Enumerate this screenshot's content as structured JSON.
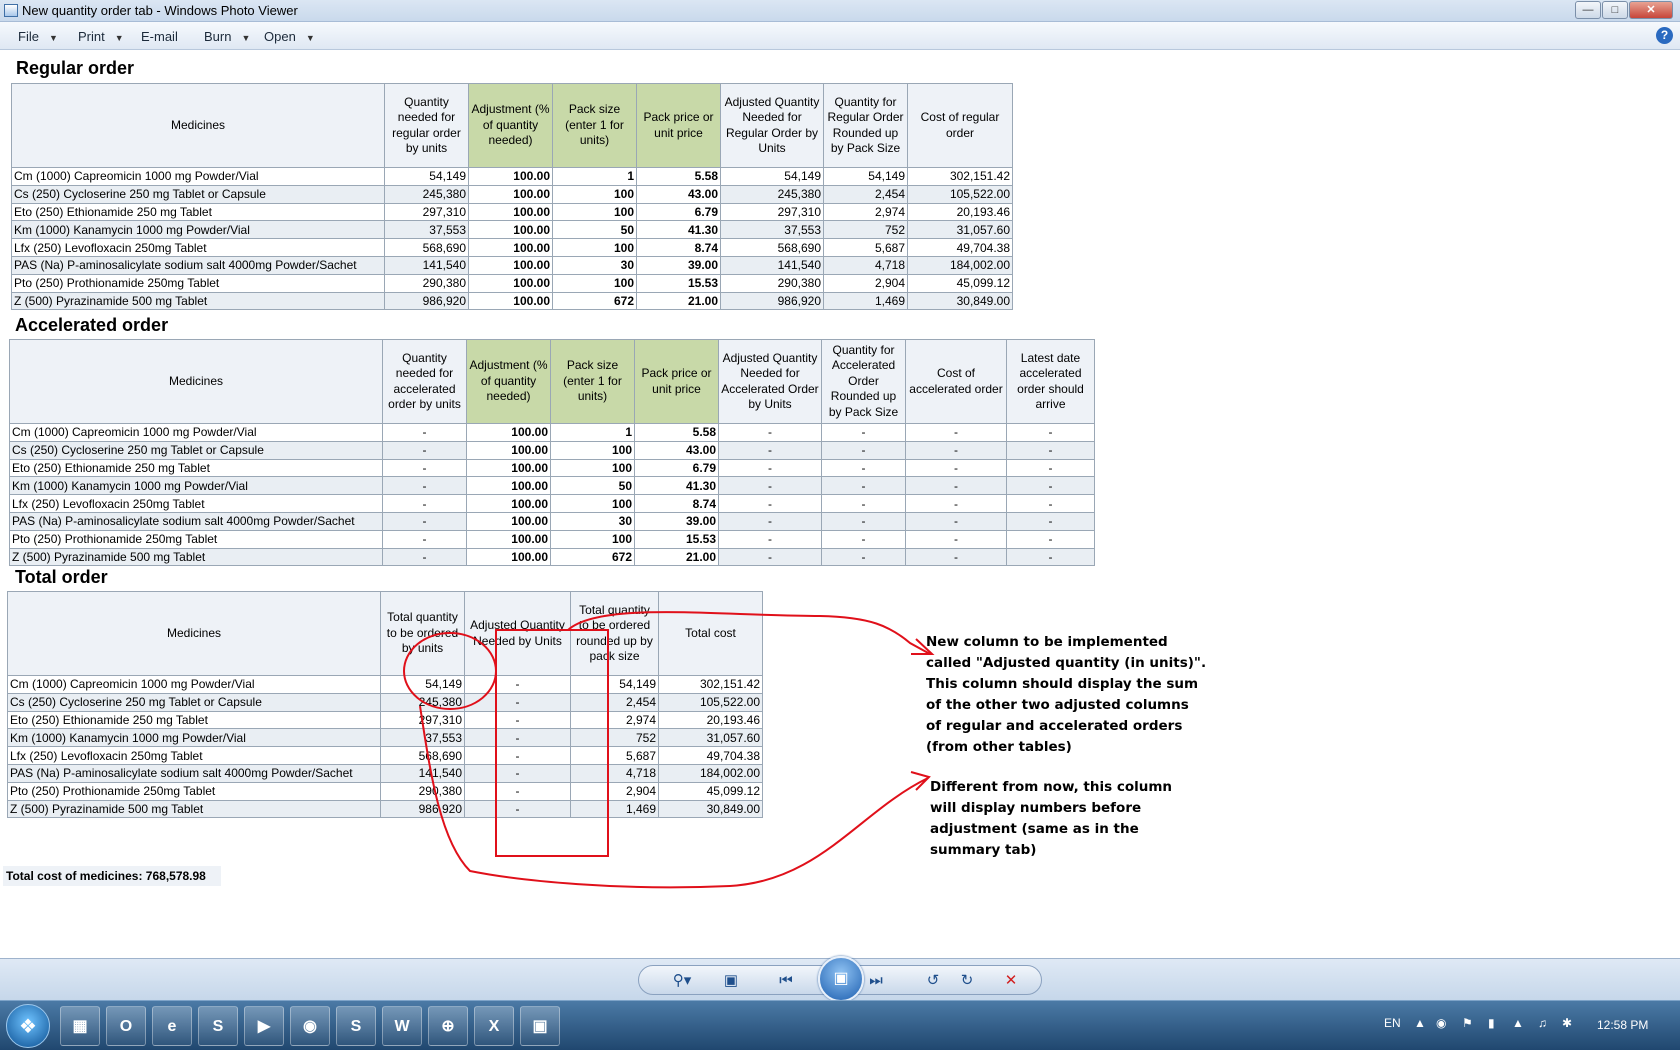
{
  "window": {
    "title": "New quantity order tab - Windows Photo Viewer",
    "controls": [
      "minimize-icon",
      "maximize-icon",
      "close-icon"
    ]
  },
  "menu": {
    "items": [
      {
        "label": "File",
        "has_caret": true
      },
      {
        "label": "Print",
        "has_caret": true
      },
      {
        "label": "E-mail",
        "has_caret": false
      },
      {
        "label": "Burn",
        "has_caret": true
      },
      {
        "label": "Open",
        "has_caret": true
      }
    ],
    "help": "?"
  },
  "regular": {
    "title": "Regular order",
    "headers": [
      "Medicines",
      "Quantity needed for regular order by units",
      "Adjustment (% of quantity needed)",
      "Pack size (enter 1 for units)",
      "Pack price or unit price",
      "Adjusted Quantity Needed for Regular Order by Units",
      "Quantity for Regular Order Rounded up by Pack Size",
      "Cost of regular order"
    ],
    "rows": [
      [
        "Cm (1000)  Capreomicin  1000 mg  Powder/Vial",
        "54,149",
        "100.00",
        "1",
        "5.58",
        "54,149",
        "54,149",
        "302,151.42"
      ],
      [
        "Cs (250)  Cycloserine  250 mg  Tablet or Capsule",
        "245,380",
        "100.00",
        "100",
        "43.00",
        "245,380",
        "2,454",
        "105,522.00"
      ],
      [
        "Eto (250)  Ethionamide  250 mg  Tablet",
        "297,310",
        "100.00",
        "100",
        "6.79",
        "297,310",
        "2,974",
        "20,193.46"
      ],
      [
        "Km (1000)  Kanamycin  1000 mg  Powder/Vial",
        "37,553",
        "100.00",
        "50",
        "41.30",
        "37,553",
        "752",
        "31,057.60"
      ],
      [
        "Lfx (250)  Levofloxacin  250mg  Tablet",
        "568,690",
        "100.00",
        "100",
        "8.74",
        "568,690",
        "5,687",
        "49,704.38"
      ],
      [
        "PAS (Na)  P-aminosalicylate sodium salt  4000mg  Powder/Sachet",
        "141,540",
        "100.00",
        "30",
        "39.00",
        "141,540",
        "4,718",
        "184,002.00"
      ],
      [
        "Pto (250)  Prothionamide   250mg  Tablet",
        "290,380",
        "100.00",
        "100",
        "15.53",
        "290,380",
        "2,904",
        "45,099.12"
      ],
      [
        "Z (500)  Pyrazinamide  500 mg  Tablet",
        "986,920",
        "100.00",
        "672",
        "21.00",
        "986,920",
        "1,469",
        "30,849.00"
      ]
    ]
  },
  "accelerated": {
    "title": "Accelerated order",
    "headers": [
      "Medicines",
      "Quantity needed for accelerated order by units",
      "Adjustment (% of quantity needed)",
      "Pack size (enter 1 for units)",
      "Pack price or unit price",
      "Adjusted Quantity Needed for Accelerated Order by Units",
      "Quantity for Accelerated Order Rounded up by Pack Size",
      "Cost of accelerated order",
      "Latest date accelerated order should arrive"
    ],
    "rows": [
      [
        "Cm (1000)  Capreomicin  1000 mg  Powder/Vial",
        "-",
        "100.00",
        "1",
        "5.58",
        "-",
        "-",
        "-",
        "-"
      ],
      [
        "Cs (250)  Cycloserine  250 mg  Tablet or Capsule",
        "-",
        "100.00",
        "100",
        "43.00",
        "-",
        "-",
        "-",
        "-"
      ],
      [
        "Eto (250)  Ethionamide  250 mg  Tablet",
        "-",
        "100.00",
        "100",
        "6.79",
        "-",
        "-",
        "-",
        "-"
      ],
      [
        "Km (1000)  Kanamycin  1000 mg  Powder/Vial",
        "-",
        "100.00",
        "50",
        "41.30",
        "-",
        "-",
        "-",
        "-"
      ],
      [
        "Lfx (250)  Levofloxacin  250mg  Tablet",
        "-",
        "100.00",
        "100",
        "8.74",
        "-",
        "-",
        "-",
        "-"
      ],
      [
        "PAS (Na)  P-aminosalicylate sodium salt  4000mg  Powder/Sachet",
        "-",
        "100.00",
        "30",
        "39.00",
        "-",
        "-",
        "-",
        "-"
      ],
      [
        "Pto (250)  Prothionamide   250mg  Tablet",
        "-",
        "100.00",
        "100",
        "15.53",
        "-",
        "-",
        "-",
        "-"
      ],
      [
        "Z (500)  Pyrazinamide  500 mg  Tablet",
        "-",
        "100.00",
        "672",
        "21.00",
        "-",
        "-",
        "-",
        "-"
      ]
    ]
  },
  "total": {
    "title": "Total order",
    "headers": [
      "Medicines",
      "Total quantity to be ordered by units",
      "Adjusted Quantity Needed by Units",
      "Total quantity to be ordered rounded up by pack size",
      "Total cost"
    ],
    "rows": [
      [
        "Cm (1000)  Capreomicin  1000 mg  Powder/Vial",
        "54,149",
        "-",
        "54,149",
        "302,151.42"
      ],
      [
        "Cs (250)  Cycloserine  250 mg  Tablet or Capsule",
        "245,380",
        "-",
        "2,454",
        "105,522.00"
      ],
      [
        "Eto (250)  Ethionamide  250 mg  Tablet",
        "297,310",
        "-",
        "2,974",
        "20,193.46"
      ],
      [
        "Km (1000)  Kanamycin  1000 mg  Powder/Vial",
        "37,553",
        "-",
        "752",
        "31,057.60"
      ],
      [
        "Lfx (250)  Levofloxacin  250mg  Tablet",
        "568,690",
        "-",
        "5,687",
        "49,704.38"
      ],
      [
        "PAS (Na)  P-aminosalicylate sodium salt  4000mg  Powder/Sachet",
        "141,540",
        "-",
        "4,718",
        "184,002.00"
      ],
      [
        "Pto (250)  Prothionamide   250mg  Tablet",
        "290,380",
        "-",
        "2,904",
        "45,099.12"
      ],
      [
        "Z (500)  Pyrazinamide  500 mg  Tablet",
        "986,920",
        "-",
        "1,469",
        "30,849.00"
      ]
    ],
    "total_cost_line": "Total cost of medicines: 768,578.98"
  },
  "annotations": {
    "note1": "New column to be implemented\ncalled \"Adjusted quantity (in units)\".\nThis column should display the sum\nof the other   two adjusted columns\nof regular and accelerated orders\n(from other tables)",
    "note2": "Different from now, this column\nwill display numbers before\nadjustment (same as in the\nsummary tab)",
    "color": "#e0101a"
  },
  "viewer_controls": [
    "zoom-icon",
    "fit-icon",
    "previous-icon",
    "slideshow-icon",
    "next-icon",
    "rotate-left-icon",
    "rotate-right-icon",
    "delete-icon"
  ],
  "taskbar": {
    "apps": [
      {
        "icon": "explorer-icon",
        "glyph": "▦"
      },
      {
        "icon": "outlook-icon",
        "glyph": "O"
      },
      {
        "icon": "ie-icon",
        "glyph": "e"
      },
      {
        "icon": "skype-icon",
        "glyph": "S"
      },
      {
        "icon": "media-icon",
        "glyph": "▶"
      },
      {
        "icon": "chrome-icon",
        "glyph": "◉"
      },
      {
        "icon": "skype-business-icon",
        "glyph": "S"
      },
      {
        "icon": "word-icon",
        "glyph": "W"
      },
      {
        "icon": "app-icon",
        "glyph": "⊕"
      },
      {
        "icon": "excel-icon",
        "glyph": "X"
      },
      {
        "icon": "photo-viewer-icon",
        "glyph": "▣"
      }
    ],
    "language": "EN",
    "clock": "12:58 PM"
  }
}
